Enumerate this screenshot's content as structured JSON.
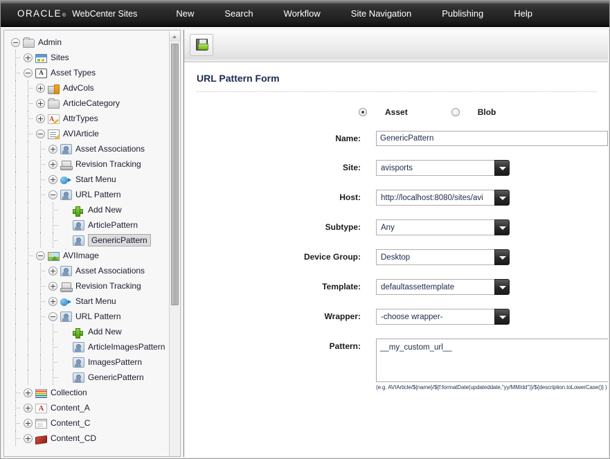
{
  "header": {
    "brand_oracle": "ORACLE",
    "brand_registered": "®",
    "brand_product": "WebCenter Sites",
    "nav": [
      {
        "label": "New"
      },
      {
        "label": "Search"
      },
      {
        "label": "Workflow"
      },
      {
        "label": "Site Navigation"
      },
      {
        "label": "Publishing"
      },
      {
        "label": "Help"
      }
    ]
  },
  "tree": {
    "nodes": [
      {
        "label": "Admin",
        "depth": 0,
        "toggle": "minus",
        "icon": "folder-open-icon"
      },
      {
        "label": "Sites",
        "depth": 1,
        "toggle": "plus",
        "icon": "sites-icon"
      },
      {
        "label": "Asset Types",
        "depth": 1,
        "toggle": "minus",
        "icon": "asset-type-icon"
      },
      {
        "label": "AdvCols",
        "depth": 2,
        "toggle": "plus",
        "icon": "advcols-icon"
      },
      {
        "label": "ArticleCategory",
        "depth": 2,
        "toggle": "plus",
        "icon": "folder-icon"
      },
      {
        "label": "AttrTypes",
        "depth": 2,
        "toggle": "plus",
        "icon": "attrtypes-icon"
      },
      {
        "label": "AVIArticle",
        "depth": 2,
        "toggle": "minus",
        "icon": "article-icon"
      },
      {
        "label": "Asset Associations",
        "depth": 3,
        "toggle": "plus",
        "icon": "asset-association-icon"
      },
      {
        "label": "Revision Tracking",
        "depth": 3,
        "toggle": "plus",
        "icon": "revision-tracking-icon"
      },
      {
        "label": "Start Menu",
        "depth": 3,
        "toggle": "plus",
        "icon": "start-menu-icon"
      },
      {
        "label": "URL Pattern",
        "depth": 3,
        "toggle": "minus",
        "icon": "url-pattern-icon"
      },
      {
        "label": "Add New",
        "depth": 4,
        "toggle": "none",
        "icon": "plus-icon"
      },
      {
        "label": "ArticlePattern",
        "depth": 4,
        "toggle": "none",
        "icon": "url-pattern-icon"
      },
      {
        "label": "GenericPattern",
        "depth": 4,
        "toggle": "none",
        "icon": "url-pattern-icon",
        "selected": true
      },
      {
        "label": "AVIImage",
        "depth": 2,
        "toggle": "minus",
        "icon": "image-icon"
      },
      {
        "label": "Asset Associations",
        "depth": 3,
        "toggle": "plus",
        "icon": "asset-association-icon"
      },
      {
        "label": "Revision Tracking",
        "depth": 3,
        "toggle": "plus",
        "icon": "revision-tracking-icon"
      },
      {
        "label": "Start Menu",
        "depth": 3,
        "toggle": "plus",
        "icon": "start-menu-icon"
      },
      {
        "label": "URL Pattern",
        "depth": 3,
        "toggle": "minus",
        "icon": "url-pattern-icon"
      },
      {
        "label": "Add New",
        "depth": 4,
        "toggle": "none",
        "icon": "plus-icon"
      },
      {
        "label": "ArticleImagesPattern",
        "depth": 4,
        "toggle": "none",
        "icon": "url-pattern-icon"
      },
      {
        "label": "ImagesPattern",
        "depth": 4,
        "toggle": "none",
        "icon": "url-pattern-icon"
      },
      {
        "label": "GenericPattern",
        "depth": 4,
        "toggle": "none",
        "icon": "url-pattern-icon"
      },
      {
        "label": "Collection",
        "depth": 1,
        "toggle": "plus",
        "icon": "collection-icon"
      },
      {
        "label": "Content_A",
        "depth": 1,
        "toggle": "plus",
        "icon": "content-a-icon"
      },
      {
        "label": "Content_C",
        "depth": 1,
        "toggle": "plus",
        "icon": "content-c-icon"
      },
      {
        "label": "Content_CD",
        "depth": 1,
        "toggle": "plus",
        "icon": "content-cd-icon"
      }
    ]
  },
  "toolbar": {
    "save_icon": "save-icon",
    "save_title": "Save"
  },
  "form": {
    "title": "URL Pattern Form",
    "type_options": [
      {
        "label": "Asset",
        "checked": true
      },
      {
        "label": "Blob",
        "checked": false
      }
    ],
    "fields": {
      "name": {
        "label": "Name:",
        "value": "GenericPattern"
      },
      "site": {
        "label": "Site:",
        "value": "avisports"
      },
      "host": {
        "label": "Host:",
        "value": "http://localhost:8080/sites/avi"
      },
      "subtype": {
        "label": "Subtype:",
        "value": "Any"
      },
      "device_group": {
        "label": "Device Group:",
        "value": "Desktop"
      },
      "template": {
        "label": "Template:",
        "value": "defaultassettemplate"
      },
      "wrapper": {
        "label": "Wrapper:",
        "value": "-choose wrapper-"
      },
      "pattern": {
        "label": "Pattern:",
        "value": "__my_custom_url__",
        "hint": "(e.g. AVIArticle/${name}/${f:formatDate(updateddate,\"yy/MM/dd\")}/${description.toLowerCase()} )"
      }
    }
  },
  "colors": {
    "header_bg": "#222222",
    "title_blue": "#1b2a52",
    "panel_bg": "#f7f7f7",
    "accent_green": "#74b81f"
  }
}
